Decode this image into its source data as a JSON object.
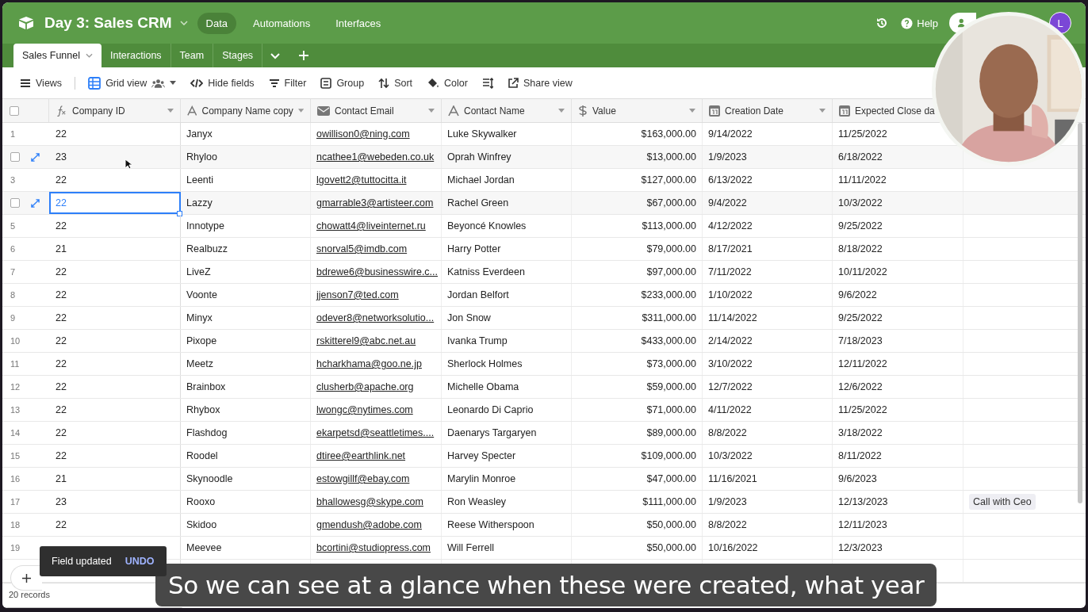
{
  "base": {
    "title": "Day 3: Sales CRM",
    "nav": [
      {
        "label": "Data",
        "selected": true
      },
      {
        "label": "Automations",
        "selected": false
      },
      {
        "label": "Interfaces",
        "selected": false
      }
    ],
    "help": "Help",
    "avatar": "L"
  },
  "tabs": [
    {
      "label": "Sales Funnel",
      "selected": true
    },
    {
      "label": "Interactions",
      "selected": false
    },
    {
      "label": "Team",
      "selected": false
    },
    {
      "label": "Stages",
      "selected": false
    }
  ],
  "toolbar": [
    {
      "kind": "views",
      "label": "Views"
    },
    {
      "kind": "grid",
      "label": "Grid view"
    },
    {
      "kind": "hide",
      "label": "Hide fields"
    },
    {
      "kind": "filter",
      "label": "Filter"
    },
    {
      "kind": "group",
      "label": "Group"
    },
    {
      "kind": "sort",
      "label": "Sort"
    },
    {
      "kind": "color",
      "label": "Color"
    },
    {
      "kind": "height"
    },
    {
      "kind": "share",
      "label": "Share view"
    }
  ],
  "select_all": {
    "checked": false
  },
  "columns": [
    {
      "name": "Company ID",
      "kind": "formula"
    },
    {
      "name": "Company Name copy",
      "kind": "text"
    },
    {
      "name": "Contact Email",
      "kind": "email"
    },
    {
      "name": "Contact Name",
      "kind": "text"
    },
    {
      "name": "Value",
      "kind": "currency"
    },
    {
      "name": "Creation Date",
      "kind": "date"
    },
    {
      "name": "Expected Close da",
      "kind": "date"
    }
  ],
  "rows": [
    {
      "number": "1",
      "hovered": false,
      "selected": false,
      "cells": [
        "22",
        "Janyx",
        "owillison0@ning.com",
        "Luke Skywalker",
        "$163,000.00",
        "9/14/2022",
        "11/25/2022"
      ]
    },
    {
      "hovered": true,
      "checked": false,
      "selected": false,
      "cells": [
        "23",
        "Rhyloo",
        "ncathee1@webeden.co.uk",
        "Oprah Winfrey",
        "$13,000.00",
        "1/9/2023",
        "6/18/2022"
      ]
    },
    {
      "number": "3",
      "hovered": false,
      "selected": false,
      "cells": [
        "22",
        "Leenti",
        "lgovett2@tuttocitta.it",
        "Michael Jordan",
        "$127,000.00",
        "6/13/2022",
        "11/11/2022"
      ]
    },
    {
      "hovered": true,
      "checked": false,
      "selected": true,
      "cells": [
        "22",
        "Lazzy",
        "gmarrable3@artisteer.com",
        "Rachel Green",
        "$67,000.00",
        "9/4/2022",
        "10/3/2022"
      ]
    },
    {
      "number": "5",
      "hovered": false,
      "selected": false,
      "cells": [
        "22",
        "Innotype",
        "chowatt4@liveinternet.ru",
        "Beyoncé Knowles",
        "$113,000.00",
        "4/12/2022",
        "9/25/2022"
      ]
    },
    {
      "number": "6",
      "hovered": false,
      "selected": false,
      "cells": [
        "21",
        "Realbuzz",
        "snorval5@imdb.com",
        "Harry Potter",
        "$79,000.00",
        "8/17/2021",
        "8/18/2022"
      ]
    },
    {
      "number": "7",
      "hovered": false,
      "selected": false,
      "cells": [
        "22",
        "LiveZ",
        "bdrewe6@businesswire.c...",
        "Katniss Everdeen",
        "$97,000.00",
        "7/11/2022",
        "10/11/2022"
      ]
    },
    {
      "number": "8",
      "hovered": false,
      "selected": false,
      "cells": [
        "22",
        "Voonte",
        "jjenson7@ted.com",
        "Jordan Belfort",
        "$233,000.00",
        "1/10/2022",
        "9/6/2022"
      ]
    },
    {
      "number": "9",
      "hovered": false,
      "selected": false,
      "cells": [
        "22",
        "Minyx",
        "odever8@networksolutio...",
        "Jon Snow",
        "$311,000.00",
        "11/14/2022",
        "9/25/2022"
      ]
    },
    {
      "number": "10",
      "hovered": false,
      "selected": false,
      "cells": [
        "22",
        "Pixope",
        "rskitterel9@abc.net.au",
        "Ivanka Trump",
        "$433,000.00",
        "2/14/2022",
        "7/18/2023"
      ]
    },
    {
      "number": "11",
      "hovered": false,
      "selected": false,
      "cells": [
        "22",
        "Meetz",
        "hcharkhama@goo.ne.jp",
        "Sherlock Holmes",
        "$73,000.00",
        "3/10/2022",
        "12/11/2022"
      ]
    },
    {
      "number": "12",
      "hovered": false,
      "selected": false,
      "cells": [
        "22",
        "Brainbox",
        "clusherb@apache.org",
        "Michelle Obama",
        "$59,000.00",
        "12/7/2022",
        "12/6/2022"
      ]
    },
    {
      "number": "13",
      "hovered": false,
      "selected": false,
      "cells": [
        "22",
        "Rhybox",
        "lwongc@nytimes.com",
        "Leonardo Di Caprio",
        "$71,000.00",
        "4/11/2022",
        "11/25/2022"
      ]
    },
    {
      "number": "14",
      "hovered": false,
      "selected": false,
      "cells": [
        "22",
        "Flashdog",
        "ekarpetsd@seattletimes....",
        "Daenarys Targaryen",
        "$89,000.00",
        "8/8/2022",
        "3/18/2022"
      ]
    },
    {
      "number": "15",
      "hovered": false,
      "selected": false,
      "cells": [
        "22",
        "Roodel",
        "dtiree@earthlink.net",
        "Harvey Specter",
        "$109,000.00",
        "10/3/2022",
        "8/11/2022"
      ]
    },
    {
      "number": "16",
      "hovered": false,
      "selected": false,
      "cells": [
        "21",
        "Skynoodle",
        "estowgillf@ebay.com",
        "Marylin Monroe",
        "$47,000.00",
        "11/16/2021",
        "9/6/2023"
      ]
    },
    {
      "number": "17",
      "hovered": false,
      "selected": false,
      "cells": [
        "23",
        "Rooxo",
        "bhallowesg@skype.com",
        "Ron Weasley",
        "$111,000.00",
        "1/9/2023",
        "12/13/2023"
      ],
      "tag": "Call with Ceo"
    },
    {
      "number": "18",
      "hovered": false,
      "selected": false,
      "cells": [
        "22",
        "Skidoo",
        "gmendush@adobe.com",
        "Reese Witherspoon",
        "$50,000.00",
        "8/8/2022",
        "12/11/2023"
      ]
    },
    {
      "number": "19",
      "hovered": false,
      "selected": false,
      "cells": [
        "",
        "Meevee",
        "bcortini@studiopress.com",
        "Will Ferrell",
        "$50,000.00",
        "10/16/2022",
        "12/3/2023"
      ]
    }
  ],
  "footer": {
    "records": "20 records"
  },
  "toast": {
    "message": "Field updated",
    "action": "UNDO"
  },
  "caption": "So we can see at a glance when these were created, what year"
}
